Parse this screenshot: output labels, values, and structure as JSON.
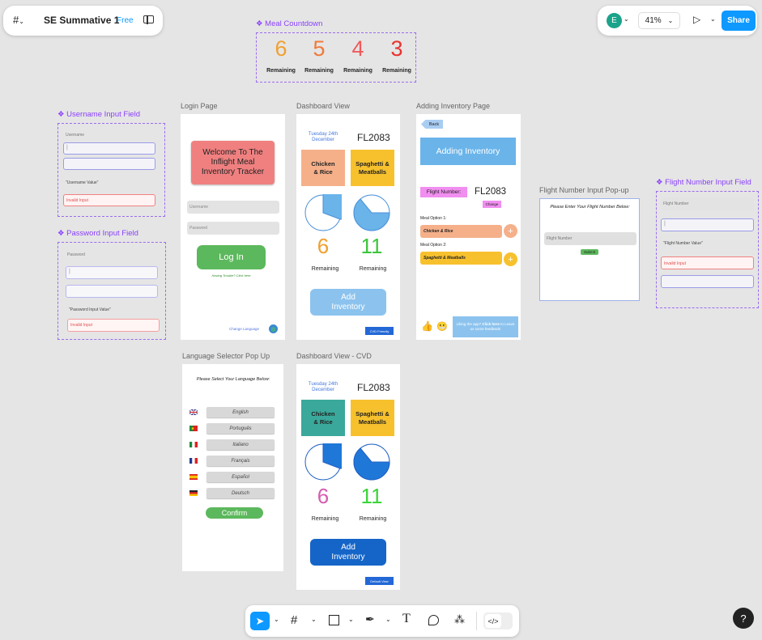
{
  "app": {
    "file_name": "SE Summative 1",
    "plan_badge": "Free",
    "avatar_letter": "E",
    "zoom": "41%",
    "share": "Share",
    "help": "?"
  },
  "countdown": {
    "title": "Meal Countdown",
    "items": [
      {
        "value": "6",
        "label": "Remaining",
        "color": "#f0a030"
      },
      {
        "value": "5",
        "label": "Remaining",
        "color": "#f07a3a"
      },
      {
        "value": "4",
        "label": "Remaining",
        "color": "#f05a5a"
      },
      {
        "value": "3",
        "label": "Remaining",
        "color": "#e8332f"
      }
    ]
  },
  "username_comp": {
    "title": "Username Input Field",
    "label": "Username",
    "value_text": "\"Username Value\"",
    "invalid": "Invalid Input"
  },
  "password_comp": {
    "title": "Password Input Field",
    "label": "Password",
    "value_text": "\"Password Input Value\"",
    "invalid": "Invalid Input"
  },
  "login": {
    "frame_label": "Login Page",
    "title": "Welcome To The Inflight Meal Inventory Tracker",
    "username_ph": "Username",
    "password_ph": "Password",
    "button": "Log In",
    "trouble": "Having Trouble? Click here",
    "change_language": "Change Language"
  },
  "dashboard": {
    "frame_label": "Dashboard View",
    "date": "Tuesday 24th December",
    "flight": "FL2083",
    "meal1": "Chicken & Rice",
    "meal2": "Spaghetti & Meatballs",
    "count1": "6",
    "count2": "11",
    "remaining": "Remaining",
    "add_btn": "Add Inventory",
    "cvd_btn": "CVD Friendly"
  },
  "dashboard_cvd": {
    "frame_label": "Dashboard View - CVD",
    "date": "Tuesday 24th December",
    "flight": "FL2083",
    "meal1": "Chicken & Rice",
    "meal2": "Spaghetti & Meatballs",
    "count1": "6",
    "count2": "11",
    "remaining": "Remaining",
    "add_btn": "Add Inventory",
    "default_btn": "Default View"
  },
  "adding": {
    "frame_label": "Adding Inventory Page",
    "back": "Back",
    "title": "Adding Inventory",
    "flight_label": "Flight Number:",
    "flight": "FL2083",
    "change": "Change",
    "opt1_label": "Meal Option 1:",
    "opt1": "Chicken & Rice",
    "opt2_label": "Meal Option 2:",
    "opt2": "Spaghetti & Meatballs",
    "feedback_a": "Liking the app? ",
    "feedback_b": "Click here",
    "feedback_c": " to Leave us some feedback!"
  },
  "flight_popup": {
    "frame_label": "Flight Number Input Pop-up",
    "prompt": "Please Enter Your Flight Number Below:",
    "placeholder": "Flight Number",
    "submit": "Submit"
  },
  "flight_comp": {
    "title": "Flight Number Input Field",
    "label": "Flight Number",
    "value_text": "\"Flight Number Value\"",
    "invalid": "Invalid Input"
  },
  "language": {
    "frame_label": "Language Selector Pop Up",
    "prompt": "Please Select Your Language Below:",
    "options": [
      "English",
      "Português",
      "Italiano",
      "Français",
      "Español",
      "Deutsch"
    ],
    "confirm": "Confirm"
  },
  "colors": {
    "accent": "#0d99ff",
    "purple": "#8a3ffc",
    "green": "#5cb85c",
    "blue": "#6ab4ea"
  }
}
